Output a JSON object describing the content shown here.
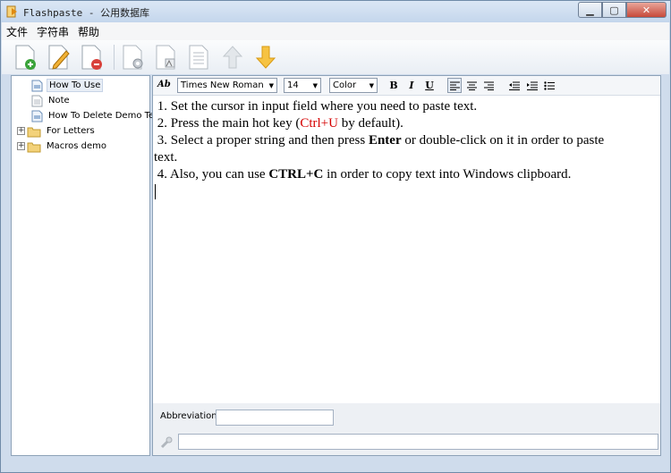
{
  "window": {
    "title": "Flashpaste - 公用数据库"
  },
  "menu": {
    "items": [
      "文件",
      "字符串",
      "帮助"
    ]
  },
  "toolbar": {
    "buttons": [
      "add-icon",
      "edit-icon",
      "delete-icon",
      "settings-icon",
      "abbreviation-icon",
      "text-icon",
      "move-up-icon",
      "move-down-icon"
    ]
  },
  "tree": {
    "items": [
      {
        "label": "How To Use",
        "type": "doc",
        "selected": true
      },
      {
        "label": "Note",
        "type": "doc",
        "selected": false
      },
      {
        "label": "How To Delete Demo Text",
        "type": "doc",
        "selected": false
      },
      {
        "label": "For Letters",
        "type": "folder",
        "selected": false
      },
      {
        "label": "Macros demo",
        "type": "folder",
        "selected": false
      }
    ]
  },
  "format": {
    "font": "Times New Roman",
    "size": "14",
    "color": "Color",
    "bold": "B",
    "italic": "I",
    "underline": "U",
    "style_label": "Ab"
  },
  "editor": {
    "line1": "1. Set the cursor in input field where you need to paste text.",
    "line2_pre": "2. Press the main hot key (",
    "line2_red": "Ctrl+U",
    "line2_post": " by default).",
    "line3_pre": "3. Select a proper string and then press ",
    "line3_bold": "Enter",
    "line3_post": " or double-click on it in order to paste",
    "line3_wrap": "text.",
    "line4_pre": "4. Also, you can use ",
    "line4_bold": "CTRL+C",
    "line4_post": " in order to copy text into Windows clipboard."
  },
  "abbreviation": {
    "label": "Abbreviation:",
    "value": ""
  },
  "hotkey": {
    "value": ""
  },
  "colors": {
    "accent": "#4a7ab5",
    "red_text": "#d50000",
    "toolbar_green": "#3aa33a",
    "toolbar_red": "#d8403a",
    "arrow_yellow": "#f0b020"
  }
}
